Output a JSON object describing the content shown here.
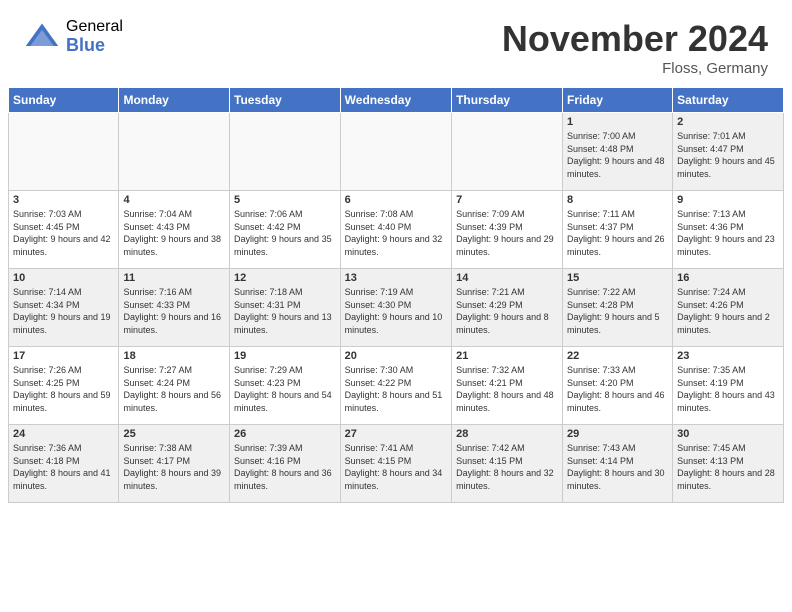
{
  "logo": {
    "general": "General",
    "blue": "Blue"
  },
  "title": "November 2024",
  "location": "Floss, Germany",
  "headers": [
    "Sunday",
    "Monday",
    "Tuesday",
    "Wednesday",
    "Thursday",
    "Friday",
    "Saturday"
  ],
  "weeks": [
    [
      {
        "day": "",
        "empty": true
      },
      {
        "day": "",
        "empty": true
      },
      {
        "day": "",
        "empty": true
      },
      {
        "day": "",
        "empty": true
      },
      {
        "day": "",
        "empty": true
      },
      {
        "day": "1",
        "sunrise": "7:00 AM",
        "sunset": "4:48 PM",
        "daylight": "9 hours and 48 minutes."
      },
      {
        "day": "2",
        "sunrise": "7:01 AM",
        "sunset": "4:47 PM",
        "daylight": "9 hours and 45 minutes."
      }
    ],
    [
      {
        "day": "3",
        "sunrise": "7:03 AM",
        "sunset": "4:45 PM",
        "daylight": "9 hours and 42 minutes."
      },
      {
        "day": "4",
        "sunrise": "7:04 AM",
        "sunset": "4:43 PM",
        "daylight": "9 hours and 38 minutes."
      },
      {
        "day": "5",
        "sunrise": "7:06 AM",
        "sunset": "4:42 PM",
        "daylight": "9 hours and 35 minutes."
      },
      {
        "day": "6",
        "sunrise": "7:08 AM",
        "sunset": "4:40 PM",
        "daylight": "9 hours and 32 minutes."
      },
      {
        "day": "7",
        "sunrise": "7:09 AM",
        "sunset": "4:39 PM",
        "daylight": "9 hours and 29 minutes."
      },
      {
        "day": "8",
        "sunrise": "7:11 AM",
        "sunset": "4:37 PM",
        "daylight": "9 hours and 26 minutes."
      },
      {
        "day": "9",
        "sunrise": "7:13 AM",
        "sunset": "4:36 PM",
        "daylight": "9 hours and 23 minutes."
      }
    ],
    [
      {
        "day": "10",
        "sunrise": "7:14 AM",
        "sunset": "4:34 PM",
        "daylight": "9 hours and 19 minutes."
      },
      {
        "day": "11",
        "sunrise": "7:16 AM",
        "sunset": "4:33 PM",
        "daylight": "9 hours and 16 minutes."
      },
      {
        "day": "12",
        "sunrise": "7:18 AM",
        "sunset": "4:31 PM",
        "daylight": "9 hours and 13 minutes."
      },
      {
        "day": "13",
        "sunrise": "7:19 AM",
        "sunset": "4:30 PM",
        "daylight": "9 hours and 10 minutes."
      },
      {
        "day": "14",
        "sunrise": "7:21 AM",
        "sunset": "4:29 PM",
        "daylight": "9 hours and 8 minutes."
      },
      {
        "day": "15",
        "sunrise": "7:22 AM",
        "sunset": "4:28 PM",
        "daylight": "9 hours and 5 minutes."
      },
      {
        "day": "16",
        "sunrise": "7:24 AM",
        "sunset": "4:26 PM",
        "daylight": "9 hours and 2 minutes."
      }
    ],
    [
      {
        "day": "17",
        "sunrise": "7:26 AM",
        "sunset": "4:25 PM",
        "daylight": "8 hours and 59 minutes."
      },
      {
        "day": "18",
        "sunrise": "7:27 AM",
        "sunset": "4:24 PM",
        "daylight": "8 hours and 56 minutes."
      },
      {
        "day": "19",
        "sunrise": "7:29 AM",
        "sunset": "4:23 PM",
        "daylight": "8 hours and 54 minutes."
      },
      {
        "day": "20",
        "sunrise": "7:30 AM",
        "sunset": "4:22 PM",
        "daylight": "8 hours and 51 minutes."
      },
      {
        "day": "21",
        "sunrise": "7:32 AM",
        "sunset": "4:21 PM",
        "daylight": "8 hours and 48 minutes."
      },
      {
        "day": "22",
        "sunrise": "7:33 AM",
        "sunset": "4:20 PM",
        "daylight": "8 hours and 46 minutes."
      },
      {
        "day": "23",
        "sunrise": "7:35 AM",
        "sunset": "4:19 PM",
        "daylight": "8 hours and 43 minutes."
      }
    ],
    [
      {
        "day": "24",
        "sunrise": "7:36 AM",
        "sunset": "4:18 PM",
        "daylight": "8 hours and 41 minutes."
      },
      {
        "day": "25",
        "sunrise": "7:38 AM",
        "sunset": "4:17 PM",
        "daylight": "8 hours and 39 minutes."
      },
      {
        "day": "26",
        "sunrise": "7:39 AM",
        "sunset": "4:16 PM",
        "daylight": "8 hours and 36 minutes."
      },
      {
        "day": "27",
        "sunrise": "7:41 AM",
        "sunset": "4:15 PM",
        "daylight": "8 hours and 34 minutes."
      },
      {
        "day": "28",
        "sunrise": "7:42 AM",
        "sunset": "4:15 PM",
        "daylight": "8 hours and 32 minutes."
      },
      {
        "day": "29",
        "sunrise": "7:43 AM",
        "sunset": "4:14 PM",
        "daylight": "8 hours and 30 minutes."
      },
      {
        "day": "30",
        "sunrise": "7:45 AM",
        "sunset": "4:13 PM",
        "daylight": "8 hours and 28 minutes."
      }
    ]
  ]
}
